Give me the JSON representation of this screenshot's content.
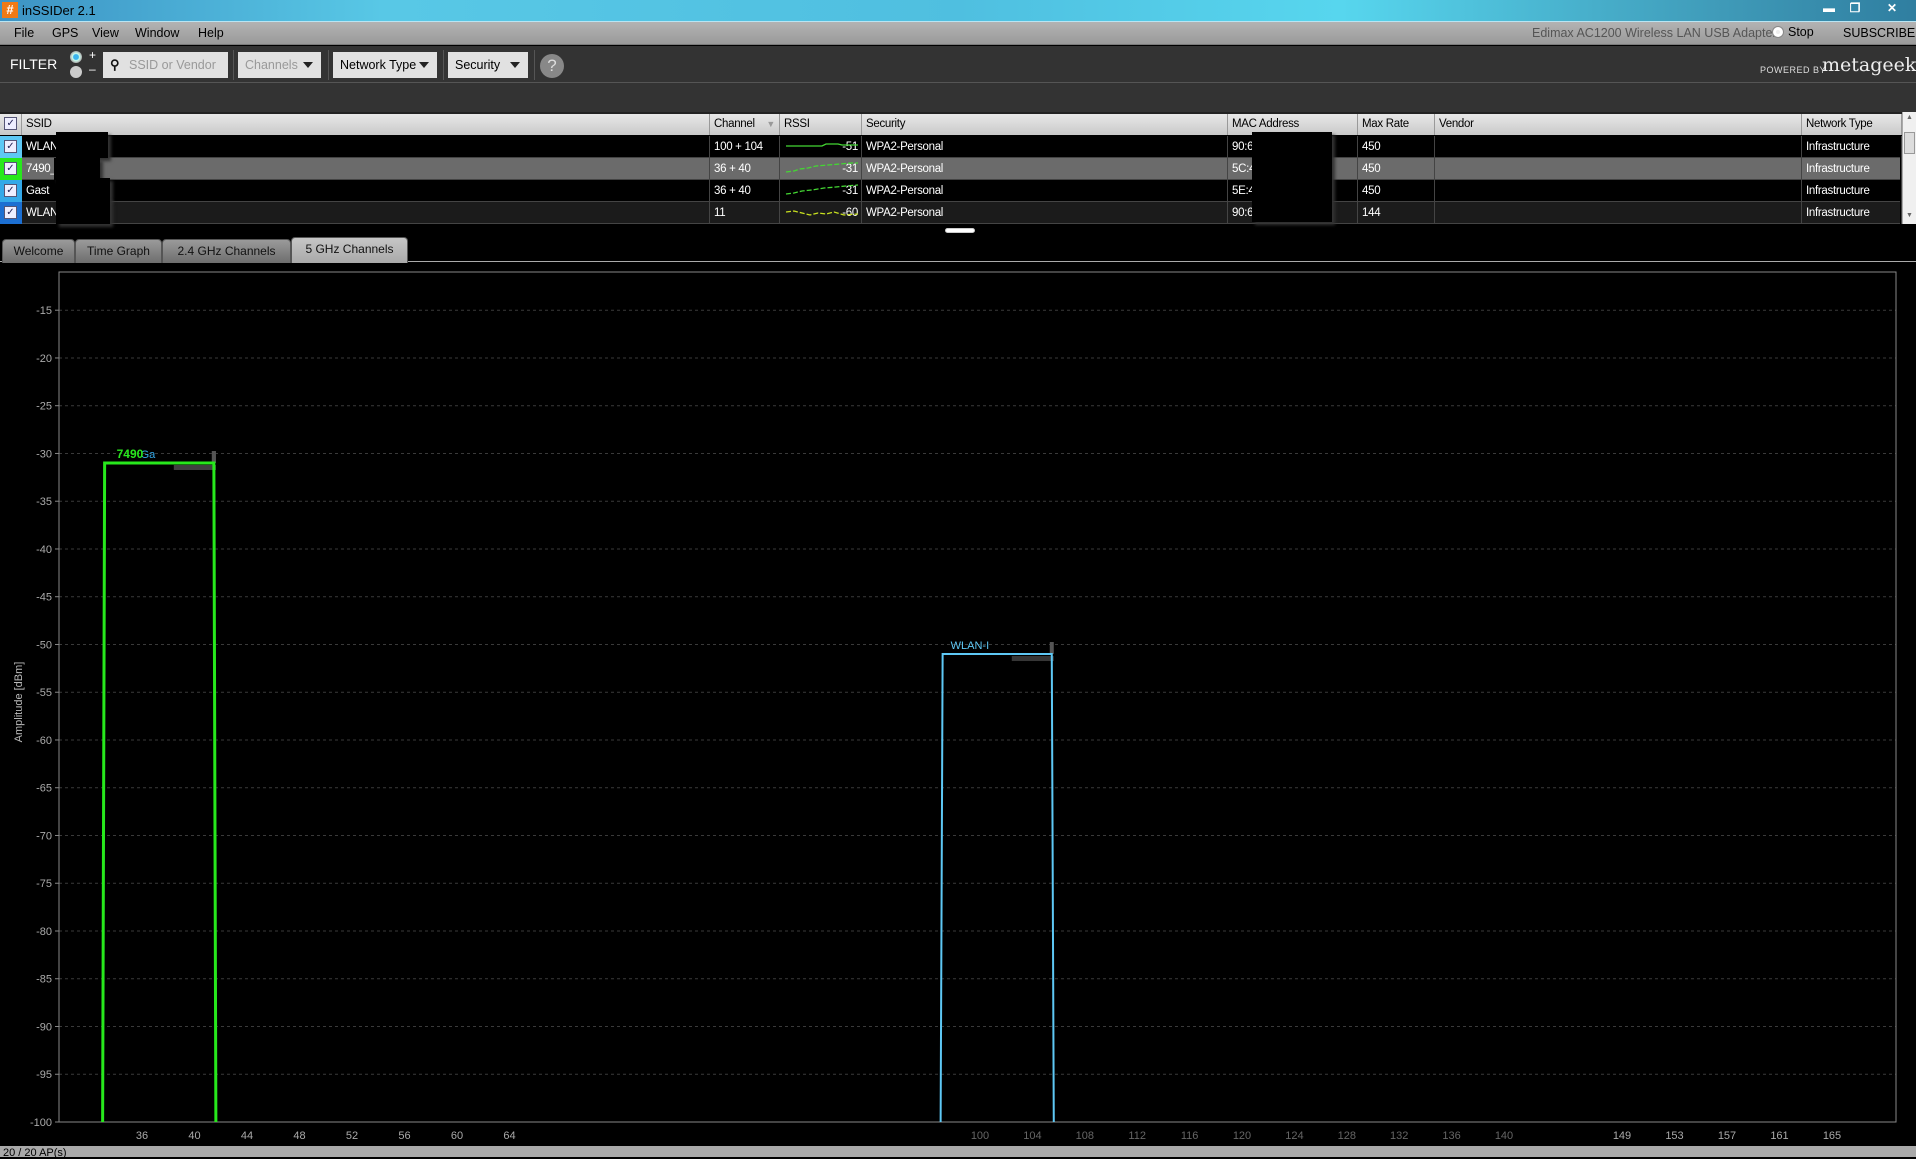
{
  "window": {
    "title": "inSSIDer 2.1",
    "app_icon": "#",
    "controls": [
      "minimize-icon",
      "restore-icon",
      "close-icon"
    ]
  },
  "menu": {
    "items": [
      "File",
      "GPS",
      "View",
      "Window",
      "Help"
    ],
    "adapter": "Edimax AC1200 Wireless LAN USB Adapter",
    "stop_label": "Stop",
    "subscribe_label": "SUBSCRIBE"
  },
  "filter": {
    "label": "FILTER",
    "mode_plus": "+",
    "mode_minus": "–",
    "mode_selected": "+",
    "search_placeholder": "SSID or Vendor",
    "channels_label": "Channels",
    "network_type_label": "Network Type",
    "security_label": "Security",
    "help_label": "?",
    "powered_by": "POWERED BY",
    "brand": "metageek"
  },
  "table": {
    "columns": [
      "SSID",
      "Channel",
      "RSSI",
      "Security",
      "MAC Address",
      "Max Rate",
      "Vendor",
      "Network Type"
    ],
    "sort_column": "Channel",
    "rows": [
      {
        "ssid": "WLAN",
        "channel": "100 + 104",
        "rssi": "-51",
        "security": "WPA2-Personal",
        "mac": "90:6",
        "max_rate": "450",
        "vendor": "",
        "network_type": "Infrastructure",
        "color": "#5ec8f5",
        "selected": false
      },
      {
        "ssid": "7490_",
        "channel": "36 + 40",
        "rssi": "-31",
        "security": "WPA2-Personal",
        "mac": "5C:4",
        "max_rate": "450",
        "vendor": "",
        "network_type": "Infrastructure",
        "color": "#27e81c",
        "selected": true
      },
      {
        "ssid": "Gast",
        "channel": "36 + 40",
        "rssi": "-31",
        "security": "WPA2-Personal",
        "mac": "5E:4",
        "max_rate": "450",
        "vendor": "",
        "network_type": "Infrastructure",
        "color": "#34a8e8",
        "selected": false
      },
      {
        "ssid": "WLAN",
        "channel": "11",
        "rssi": "-60",
        "security": "WPA2-Personal",
        "mac": "90:6",
        "max_rate": "144",
        "vendor": "",
        "network_type": "Infrastructure",
        "color": "#1c6fd2",
        "selected": false
      }
    ]
  },
  "tabs": [
    {
      "label": "Welcome",
      "active": false
    },
    {
      "label": "Time Graph",
      "active": false
    },
    {
      "label": "2.4 GHz Channels",
      "active": false
    },
    {
      "label": "5 GHz Channels",
      "active": true
    }
  ],
  "chart_data": {
    "type": "area",
    "title": "5 GHz Channels",
    "xlabel": "",
    "ylabel": "Amplitude [dBm]",
    "ylim": [
      -100,
      -11
    ],
    "yticks": [
      -15,
      -20,
      -25,
      -30,
      -35,
      -40,
      -45,
      -50,
      -55,
      -60,
      -65,
      -70,
      -75,
      -80,
      -85,
      -90,
      -95,
      -100
    ],
    "grid": true,
    "xticks": {
      "band1": [
        36,
        40,
        44,
        48,
        52,
        56,
        60,
        64
      ],
      "dfs": [
        100,
        104,
        108,
        112,
        116,
        120,
        124,
        128,
        132,
        136,
        140
      ],
      "band3": [
        149,
        153,
        157,
        161,
        165
      ]
    },
    "series": [
      {
        "name": "Gast",
        "label": "Ga",
        "channel_low": 36,
        "channel_high": 40,
        "amplitude": -31,
        "color": "#34a8e8"
      },
      {
        "name": "7490_",
        "label": "7490",
        "channel_low": 36,
        "channel_high": 40,
        "amplitude": -31,
        "color": "#27e81c"
      },
      {
        "name": "WLAN-I",
        "label": "WLAN-I",
        "channel_low": 100,
        "channel_high": 104,
        "amplitude": -51,
        "color": "#5ec8f5"
      }
    ]
  },
  "status": {
    "text": "20 / 20 AP(s)"
  }
}
